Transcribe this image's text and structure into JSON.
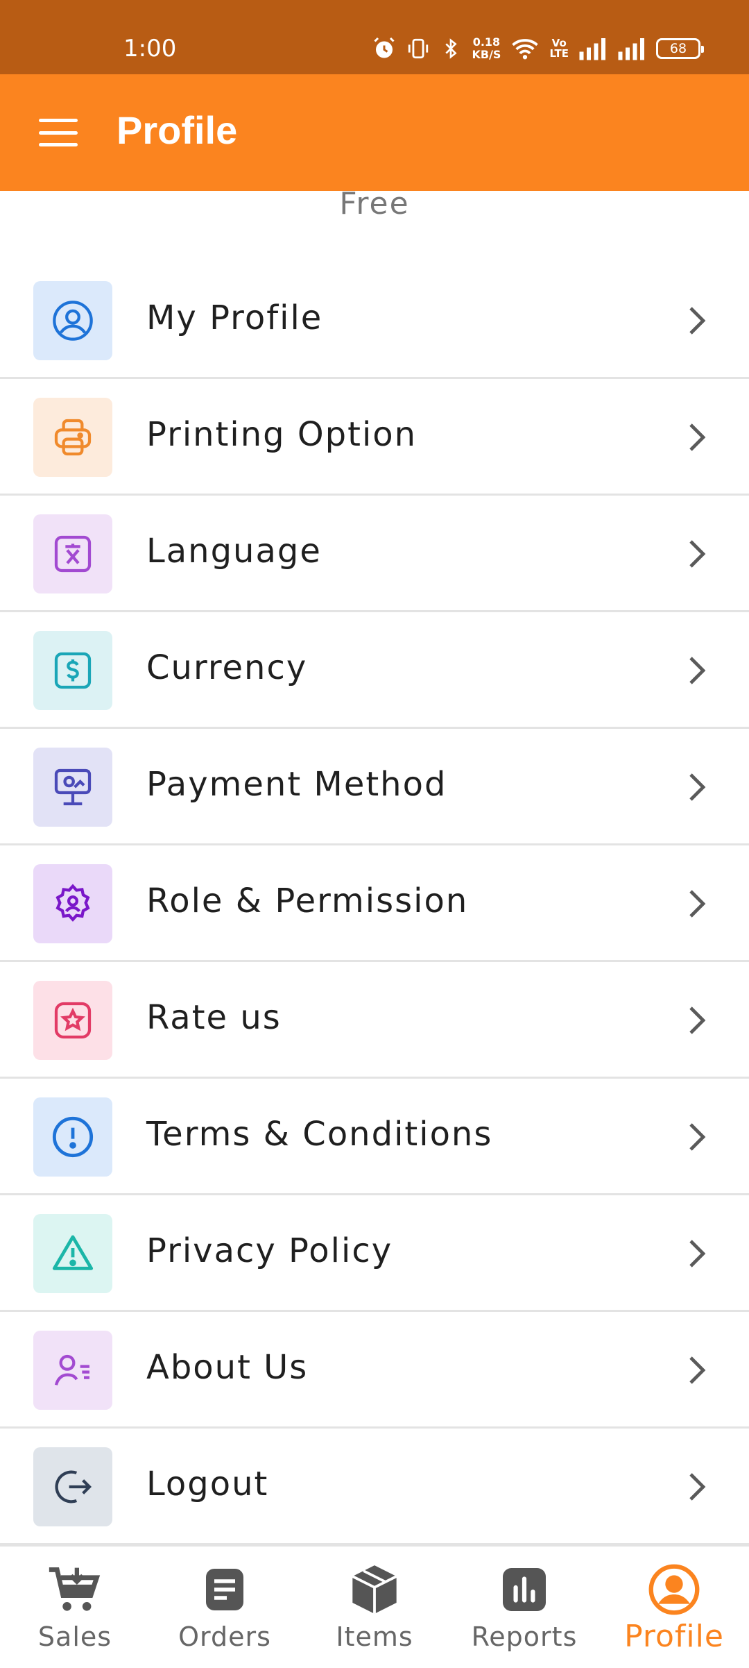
{
  "status_bar": {
    "time": "1:00",
    "speed_value": "0.18",
    "speed_unit": "KB/S",
    "volte_top": "Vo",
    "volte_bottom": "LTE",
    "battery": "68"
  },
  "app_bar": {
    "title": "Profile",
    "menu_icon": "hamburger-menu-icon"
  },
  "plan_label": "Free",
  "menu": [
    {
      "label": "My Profile",
      "icon": "user-circle-icon",
      "icon_color": "#1e73d8",
      "bg": "#dbe9fb"
    },
    {
      "label": "Printing Option",
      "icon": "printer-icon",
      "icon_color": "#f08a2c",
      "bg": "#fdebdc"
    },
    {
      "label": "Language",
      "icon": "translate-icon",
      "icon_color": "#a24ad1",
      "bg": "#f1e2f8"
    },
    {
      "label": "Currency",
      "icon": "dollar-icon",
      "icon_color": "#1aa6b7",
      "bg": "#dcf2f4"
    },
    {
      "label": "Payment Method",
      "icon": "payment-icon",
      "icon_color": "#4a4ab8",
      "bg": "#e2e2f6"
    },
    {
      "label": "Role & Permission",
      "icon": "gear-user-icon",
      "icon_color": "#7a17c9",
      "bg": "#ead9f9"
    },
    {
      "label": "Rate us",
      "icon": "star-icon",
      "icon_color": "#e23b66",
      "bg": "#fde0e7"
    },
    {
      "label": "Terms & Conditions",
      "icon": "info-circle-icon",
      "icon_color": "#1e73d8",
      "bg": "#dbe9fb"
    },
    {
      "label": "Privacy Policy",
      "icon": "warning-triangle-icon",
      "icon_color": "#1bb6a8",
      "bg": "#dcf5f2"
    },
    {
      "label": "About Us",
      "icon": "user-list-icon",
      "icon_color": "#a24ad1",
      "bg": "#f1e2f8"
    },
    {
      "label": "Logout",
      "icon": "logout-icon",
      "icon_color": "#2f3e55",
      "bg": "#dfe4ea"
    }
  ],
  "bottom_nav": [
    {
      "label": "Sales",
      "icon": "cart-icon",
      "active": false
    },
    {
      "label": "Orders",
      "icon": "document-icon",
      "active": false
    },
    {
      "label": "Items",
      "icon": "box-icon",
      "active": false
    },
    {
      "label": "Reports",
      "icon": "bar-chart-icon",
      "active": false
    },
    {
      "label": "Profile",
      "icon": "profile-icon",
      "active": true
    }
  ],
  "colors": {
    "status_bar": "#b85c14",
    "app_bar": "#fb841f",
    "active_nav": "#fb841f",
    "inactive_nav": "#666666"
  }
}
